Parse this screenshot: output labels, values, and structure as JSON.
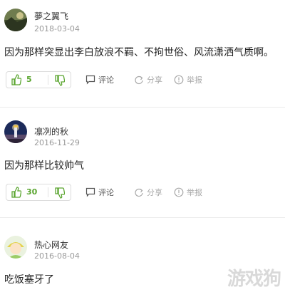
{
  "comments": [
    {
      "username": "夢之翼飞",
      "date": "2018-03-04",
      "text": "因为那样突显出李白放浪不羁、不拘世俗、风流潇洒气质啊。",
      "likes": "5",
      "comment_label": "评论",
      "share_label": "分享",
      "report_label": "举报",
      "avatar_icon": "landscape-photo-avatar"
    },
    {
      "username": "凛冽的秋",
      "date": "2016-11-29",
      "text": "因为那样比较帅气",
      "likes": "30",
      "comment_label": "评论",
      "share_label": "分享",
      "report_label": "举报",
      "avatar_icon": "lighthouse-night-avatar"
    },
    {
      "username": "热心网友",
      "date": "2016-08-04",
      "text": "吃饭塞牙了",
      "avatar_icon": "default-user-avatar"
    }
  ],
  "watermark": "游戏狗",
  "colors": {
    "like_green": "#5aa52f",
    "divider": "#ececec"
  }
}
